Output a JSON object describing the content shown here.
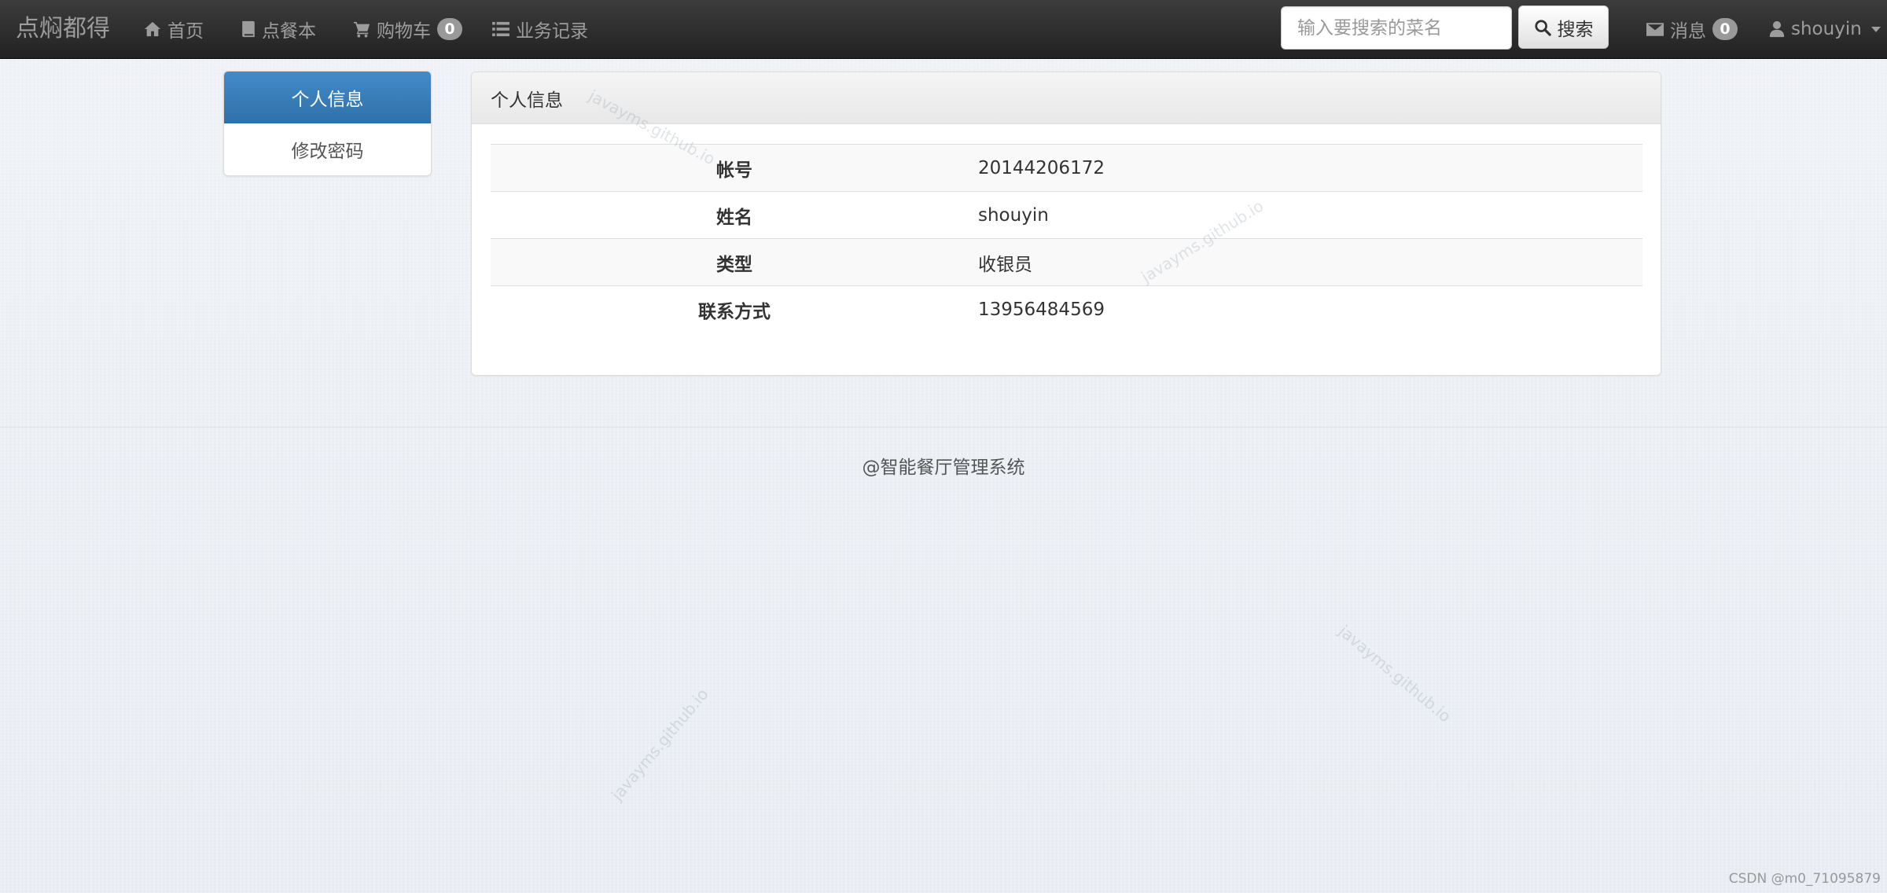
{
  "navbar": {
    "brand": "点焖都得",
    "items": [
      {
        "label": "首页",
        "icon": "home-icon"
      },
      {
        "label": "点餐本",
        "icon": "book-icon"
      },
      {
        "label": "购物车",
        "icon": "cart-icon",
        "badge": "0"
      },
      {
        "label": "业务记录",
        "icon": "list-icon"
      }
    ],
    "search": {
      "placeholder": "输入要搜索的菜名",
      "value": "",
      "button_label": "搜索"
    },
    "messages": {
      "label": "消息",
      "badge": "0",
      "icon": "envelope-icon"
    },
    "user": {
      "name": "shouyin",
      "icon": "user-icon"
    }
  },
  "sidebar": {
    "items": [
      {
        "label": "个人信息",
        "active": true
      },
      {
        "label": "修改密码",
        "active": false
      }
    ]
  },
  "panel": {
    "title": "个人信息",
    "rows": [
      {
        "label": "帐号",
        "value": "20144206172"
      },
      {
        "label": "姓名",
        "value": "shouyin"
      },
      {
        "label": "类型",
        "value": "收银员"
      },
      {
        "label": "联系方式",
        "value": "13956484569"
      }
    ]
  },
  "footer": {
    "text": "@智能餐厅管理系统"
  },
  "watermark": {
    "text": "javayms.github.io"
  },
  "credit": {
    "text": "CSDN @m0_71095879"
  },
  "colors": {
    "navbar": "#222222",
    "nav_text": "#9d9d9d",
    "active_item": "#428bca",
    "badge": "#999999"
  }
}
